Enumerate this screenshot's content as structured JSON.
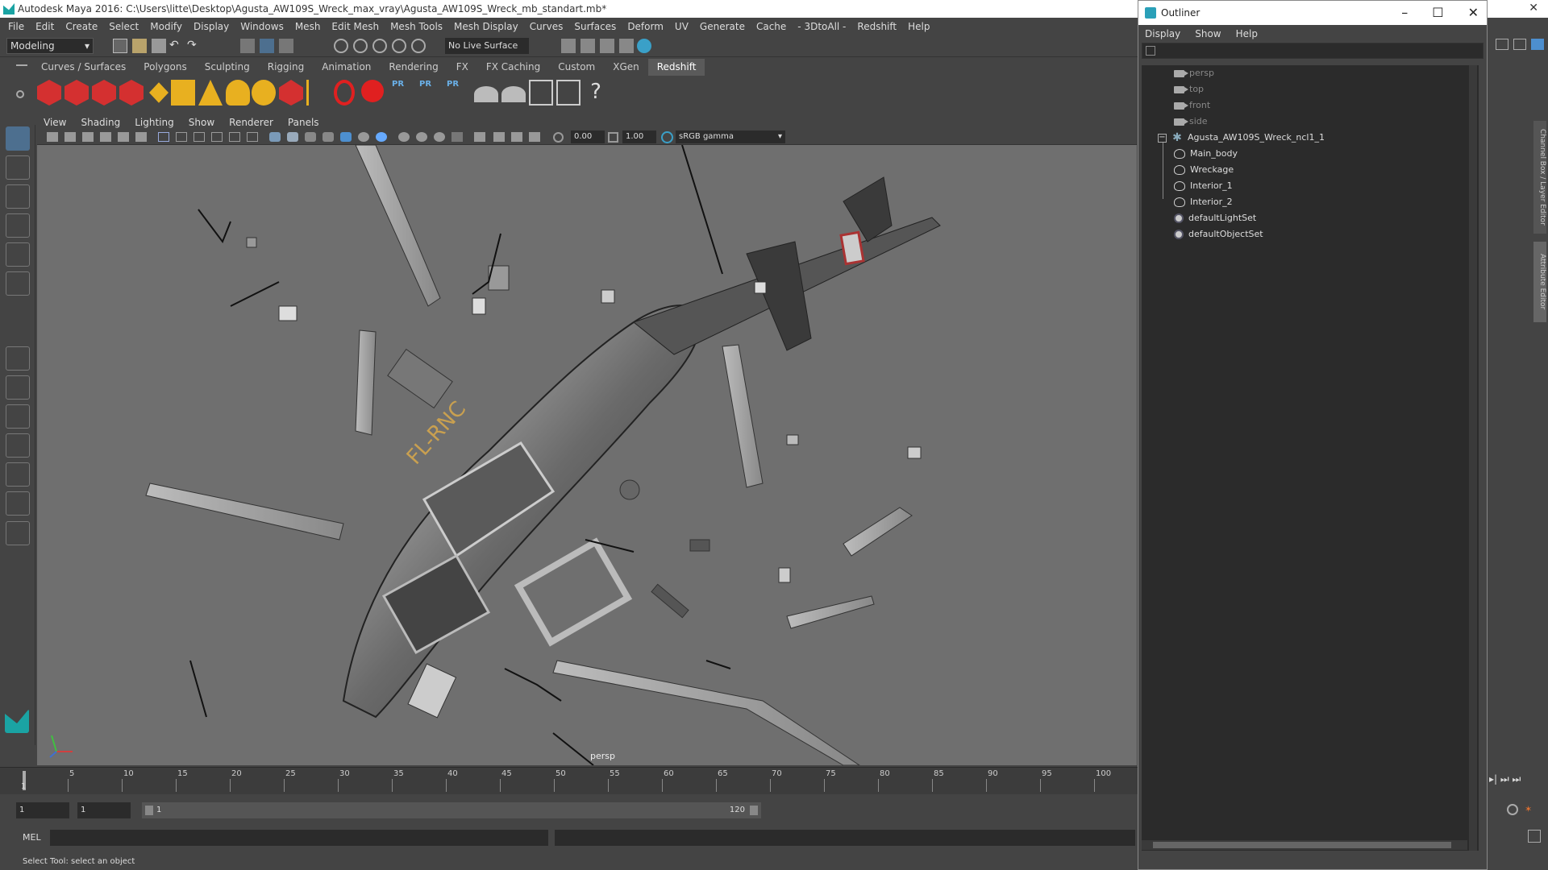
{
  "window": {
    "title": "Autodesk Maya 2016: C:\\Users\\litte\\Desktop\\Agusta_AW109S_Wreck_max_vray\\Agusta_AW109S_Wreck_mb_standart.mb*"
  },
  "menubar": [
    "File",
    "Edit",
    "Create",
    "Select",
    "Modify",
    "Display",
    "Windows",
    "Mesh",
    "Edit Mesh",
    "Mesh Tools",
    "Mesh Display",
    "Curves",
    "Surfaces",
    "Deform",
    "UV",
    "Generate",
    "Cache",
    "- 3DtoAll -",
    "Redshift",
    "Help"
  ],
  "status_line": {
    "mode": "Modeling",
    "live_surface": "No Live Surface"
  },
  "shelf_tabs": [
    "Curves / Surfaces",
    "Polygons",
    "Sculpting",
    "Rigging",
    "Animation",
    "Rendering",
    "FX",
    "FX Caching",
    "Custom",
    "XGen",
    "Redshift"
  ],
  "active_shelf_tab": "Redshift",
  "viewport": {
    "menu": [
      "View",
      "Shading",
      "Lighting",
      "Show",
      "Renderer",
      "Panels"
    ],
    "exposure": "0.00",
    "gamma": "1.00",
    "color_space": "sRGB gamma",
    "camera_label": "persp",
    "fuselage_text": "FL-RNC"
  },
  "timeline": {
    "ticks": [
      "5",
      "10",
      "15",
      "20",
      "25",
      "30",
      "35",
      "40",
      "45",
      "50",
      "55",
      "60",
      "65",
      "70",
      "75",
      "80",
      "85",
      "90",
      "95",
      "100"
    ],
    "current_frame": "1"
  },
  "range": {
    "start": "1",
    "inner_start": "1",
    "slider_start": "1",
    "slider_end": "120"
  },
  "command_line": {
    "label": "MEL"
  },
  "help_line": "Select Tool: select an object",
  "outliner": {
    "title": "Outliner",
    "menu": [
      "Display",
      "Show",
      "Help"
    ],
    "items": [
      {
        "label": "persp",
        "type": "camera"
      },
      {
        "label": "top",
        "type": "camera"
      },
      {
        "label": "front",
        "type": "camera"
      },
      {
        "label": "side",
        "type": "camera"
      },
      {
        "label": "Agusta_AW109S_Wreck_ncl1_1",
        "type": "group"
      },
      {
        "label": "Main_body",
        "type": "mesh"
      },
      {
        "label": "Wreckage",
        "type": "mesh"
      },
      {
        "label": "Interior_1",
        "type": "mesh"
      },
      {
        "label": "Interior_2",
        "type": "mesh"
      },
      {
        "label": "defaultLightSet",
        "type": "set"
      },
      {
        "label": "defaultObjectSet",
        "type": "set"
      }
    ]
  },
  "side_tabs": {
    "channel_box": "Channel Box / Layer Editor",
    "attribute_editor": "Attribute Editor"
  }
}
